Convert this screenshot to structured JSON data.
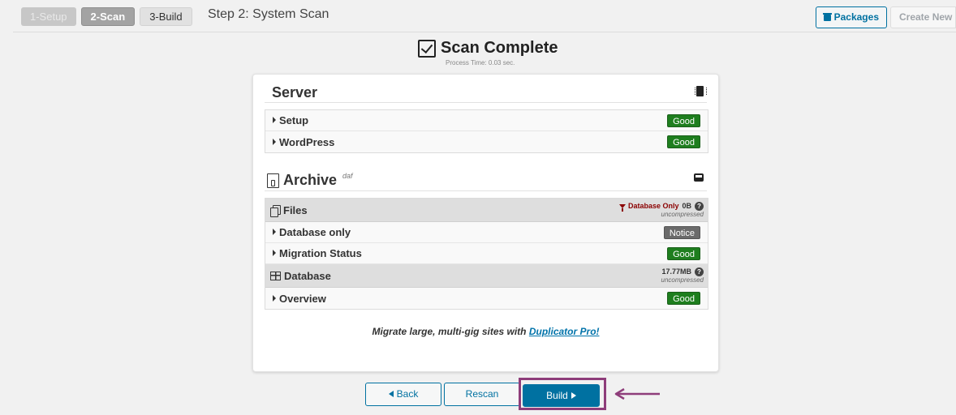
{
  "steps": [
    {
      "label": "1-Setup",
      "state": "done"
    },
    {
      "label": "2-Scan",
      "state": "active"
    },
    {
      "label": "3-Build",
      "state": "todo"
    }
  ],
  "step_title": "Step 2: System Scan",
  "top_actions": {
    "packages": "Packages",
    "create_new": "Create New"
  },
  "scan": {
    "title": "Scan Complete",
    "process_time": "Process Time: 0.03 sec."
  },
  "server": {
    "title": "Server",
    "rows": [
      {
        "label": "Setup",
        "status": "Good"
      },
      {
        "label": "WordPress",
        "status": "Good"
      }
    ]
  },
  "archive": {
    "title": "Archive",
    "name": "daf",
    "files": {
      "label": "Files",
      "filter": "Database Only",
      "size": "0B",
      "size_note": "uncompressed",
      "rows": [
        {
          "label": "Database only",
          "status": "Notice"
        },
        {
          "label": "Migration Status",
          "status": "Good"
        }
      ]
    },
    "database": {
      "label": "Database",
      "size": "17.77MB",
      "size_note": "uncompressed",
      "rows": [
        {
          "label": "Overview",
          "status": "Good"
        }
      ]
    }
  },
  "promo": {
    "text": "Migrate large, multi-gig sites with ",
    "link": "Duplicator Pro!"
  },
  "buttons": {
    "back": "Back",
    "rescan": "Rescan",
    "build": "Build"
  },
  "colors": {
    "accent": "#0071a1",
    "good": "#1e7e1e",
    "notice": "#6b6b6b",
    "highlight": "#8e3d7a"
  }
}
